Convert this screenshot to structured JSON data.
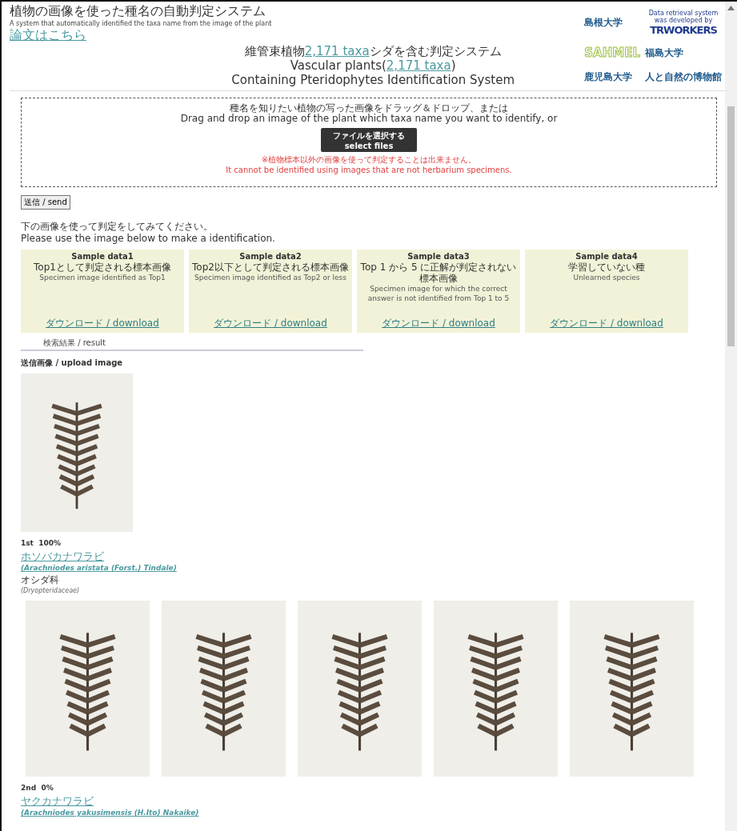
{
  "header": {
    "title": "植物の画像を使った種名の自動判定システム",
    "subtitle": "A system that automatically identified the taxa name from the image of the plant",
    "paper_link": "論文はこちら",
    "system_lines": [
      {
        "before": "維管束植物",
        "link": "2,171 taxa",
        "after": "シダを含む判定システム"
      },
      {
        "before": "Vascular plants(",
        "link": "2,171 taxa",
        "after": ")"
      },
      {
        "before": "Containing Pteridophytes Identification System"
      }
    ],
    "logos": [
      {
        "kind": "univ",
        "text": "島根大学"
      },
      {
        "kind": "credit",
        "caption": "Data retrieval system was developed by",
        "text": "TRWORKERS"
      },
      {
        "kind": "outline",
        "text": "SAHMEL"
      },
      {
        "kind": "univ",
        "text": "福島大学"
      },
      {
        "kind": "univ",
        "text": "鹿児島大学"
      },
      {
        "kind": "univ",
        "text": "人と自然の博物館"
      }
    ]
  },
  "dropzone": {
    "line_ja": "種名を知りたい植物の写った画像をドラッグ＆ドロップ、または",
    "line_en": "Drag and drop an image of the plant which taxa name you want to identify, or",
    "button": [
      "ファイルを選択する",
      "select files"
    ],
    "warning_ja": "※植物標本以外の画像を使って判定することは出来ません。",
    "warning_en": "It cannot be identified using images that are not herbarium specimens."
  },
  "send_button": "送信 / send",
  "intro": [
    "下の画像を使って判定をしてみてください。",
    "Please use the image below to make a identification."
  ],
  "samples": [
    {
      "title": "Sample data1",
      "ja": "Top1として判定される標本画像",
      "en": "Specimen image identified as Top1",
      "link": "ダウンロード / download"
    },
    {
      "title": "Sample data2",
      "ja": "Top2以下として判定される標本画像",
      "en": "Specimen image identified as Top2 or less",
      "link": "ダウンロード / download"
    },
    {
      "title": "Sample data3",
      "ja": "Top 1 から 5 に正解が判定されない標本画像",
      "en": "Specimen image for which the correct answer is not identified from Top 1 to 5",
      "link": "ダウンロード / download"
    },
    {
      "title": "Sample data4",
      "ja": "学習していない種",
      "en": "Unlearned species",
      "link": "ダウンロード / download"
    }
  ],
  "result_heading": "検索結果 / result",
  "upload_label": "送信画像 / upload image",
  "results": [
    {
      "rank": "1st",
      "score": "100%",
      "name": "ホソバカナワラビ",
      "scientific": "(Arachniodes aristata (Forst.) Tindale)",
      "family": "オシダ科",
      "family_latin": "(Dryopteridaceae)"
    },
    {
      "rank": "2nd",
      "score": "0%",
      "name": "ヤクカナワラビ",
      "scientific": "(Arachniodes yakusimensis (H.Ito) Nakaike)"
    }
  ]
}
